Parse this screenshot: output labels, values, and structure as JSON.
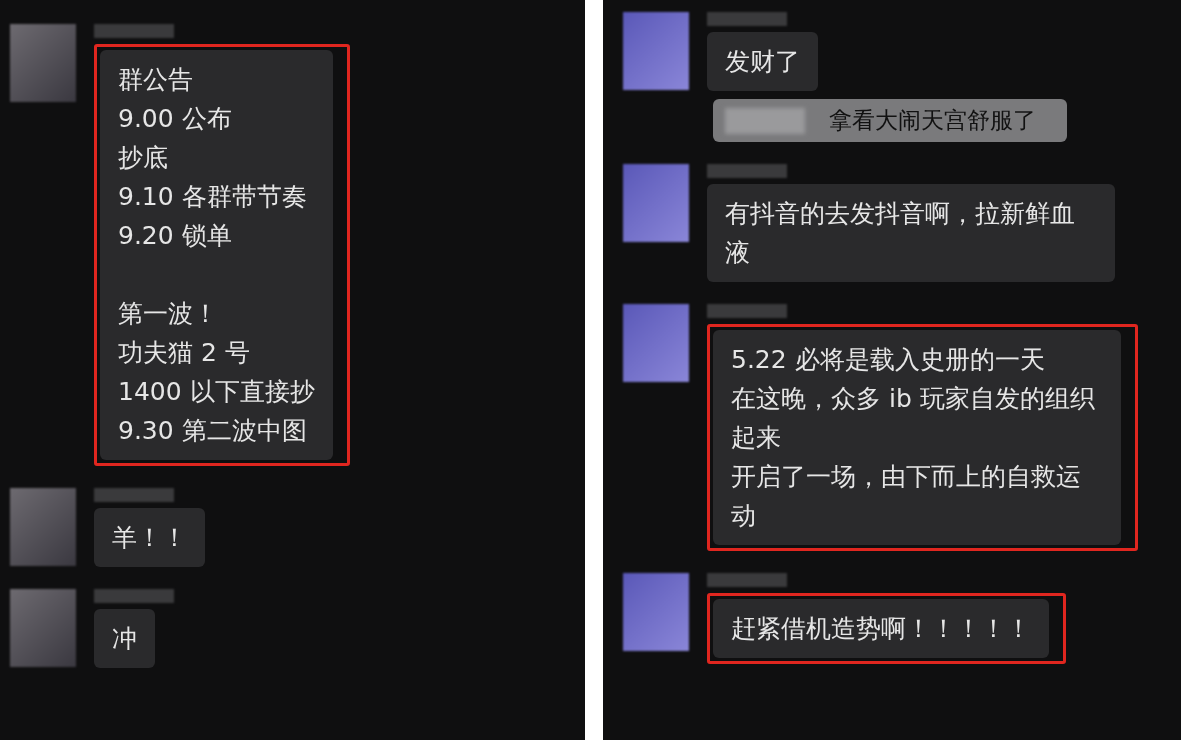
{
  "panels": [
    {
      "messages": [
        {
          "kind": "text",
          "highlighted": true,
          "paragraphs": [
            [
              "群公告",
              "9.00 公布",
              "抄底",
              "9.10 各群带节奏",
              "9.20 锁单"
            ],
            [
              "第一波！",
              "功夫猫 2 号",
              "1400 以下直接抄",
              "9.30 第二波中图"
            ]
          ]
        },
        {
          "kind": "text",
          "highlighted": false,
          "paragraphs": [
            [
              "羊！！"
            ]
          ]
        },
        {
          "kind": "text",
          "highlighted": false,
          "paragraphs": [
            [
              "冲"
            ]
          ]
        }
      ]
    },
    {
      "messages": [
        {
          "kind": "text",
          "highlighted": false,
          "paragraphs": [
            [
              "发财了"
            ]
          ]
        },
        {
          "kind": "quote",
          "text": "拿看大闹天宫舒服了"
        },
        {
          "kind": "text",
          "highlighted": false,
          "paragraphs": [
            [
              "有抖音的去发抖音啊，拉新鲜血液"
            ]
          ]
        },
        {
          "kind": "text",
          "highlighted": true,
          "paragraphs": [
            [
              "5.22 必将是载入史册的一天",
              "在这晚，众多 ib 玩家自发的组织起来",
              "开启了一场，由下而上的自救运动"
            ]
          ]
        },
        {
          "kind": "text",
          "highlighted": true,
          "paragraphs": [
            [
              "赶紧借机造势啊！！！！！"
            ]
          ]
        }
      ]
    }
  ]
}
